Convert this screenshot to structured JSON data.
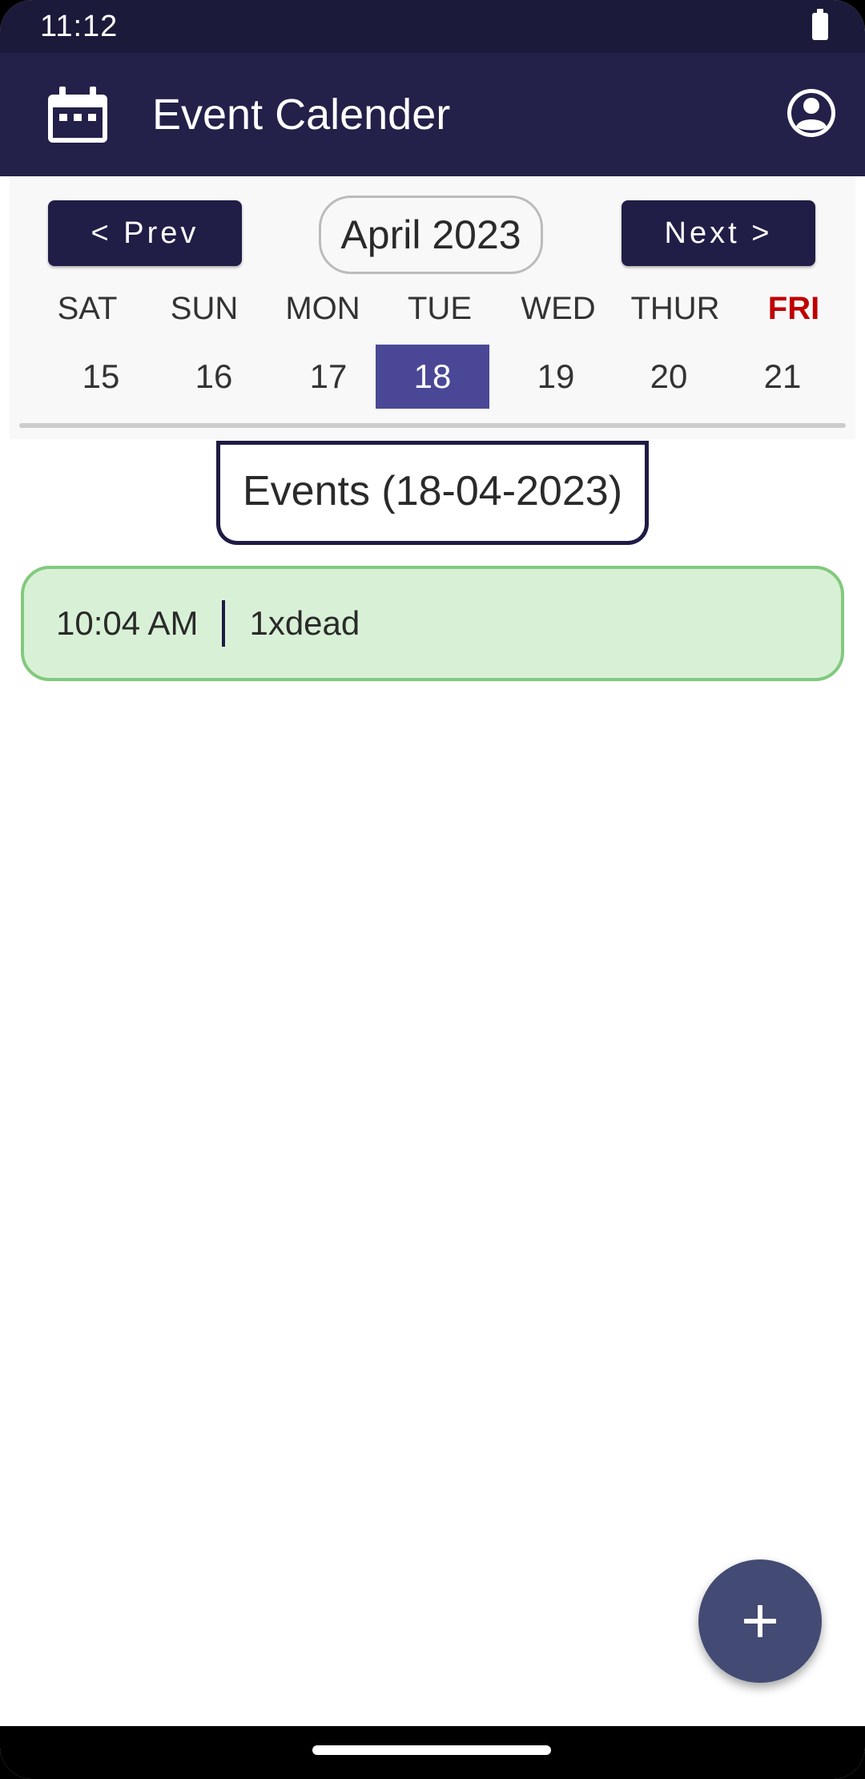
{
  "status_bar": {
    "time": "11:12",
    "battery_icon": "battery-full-icon"
  },
  "app_bar": {
    "title": "Event Calender",
    "leading_icon": "calendar-icon",
    "trailing_icon": "account-circle-icon",
    "background": "#232049"
  },
  "calendar": {
    "prev_label": "< Prev",
    "next_label": "Next >",
    "month_label": "April 2023",
    "weekdays": [
      "SAT",
      "SUN",
      "MON",
      "TUE",
      "WED",
      "THUR",
      "FRI"
    ],
    "days": [
      "15",
      "16",
      "17",
      "18",
      "19",
      "20",
      "21"
    ],
    "selected_day": "18",
    "highlight_weekday": "FRI",
    "selected_color": "#4a4896",
    "weekend_color": "#c00000"
  },
  "events": {
    "header": "Events (18-04-2023)",
    "items": [
      {
        "time": "10:04 AM",
        "title": "1xdead"
      }
    ],
    "card_color": "#d8f1d6"
  },
  "fab": {
    "icon": "plus-icon",
    "color": "#434a74"
  }
}
